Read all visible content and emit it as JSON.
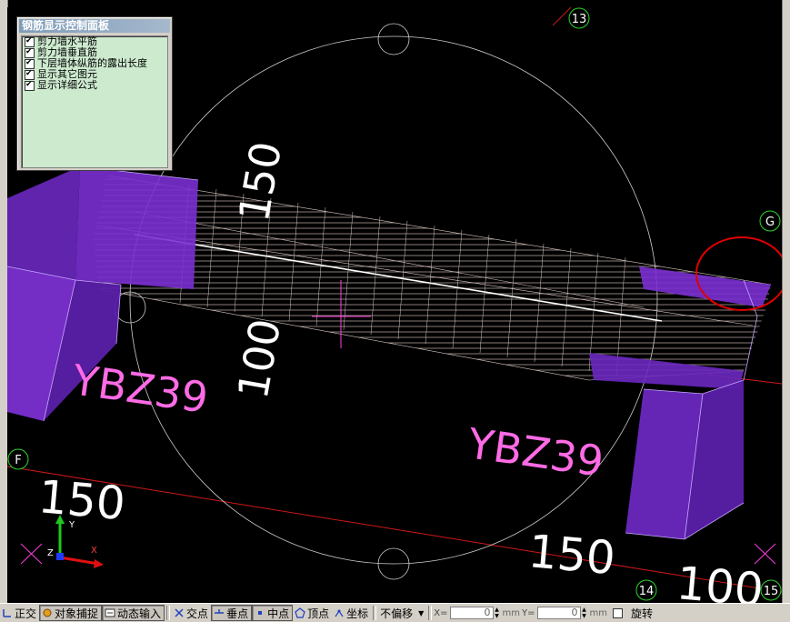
{
  "panel": {
    "title": "钢筋显示控制面板",
    "options": [
      {
        "label": "剪力墙水平筋",
        "checked": true
      },
      {
        "label": "剪力墙垂直筋",
        "checked": true
      },
      {
        "label": "下层墙体纵筋的露出长度",
        "checked": true
      },
      {
        "label": "显示其它图元",
        "checked": true
      },
      {
        "label": "显示详细公式",
        "checked": true
      }
    ]
  },
  "canvas": {
    "grid_labels": {
      "top": "13",
      "right": "G",
      "left": "F",
      "bottom_left": "14",
      "bottom_right": "15"
    },
    "component_labels": {
      "left_column": "YBZ39",
      "right_column": "YBZ39"
    },
    "dimensions": {
      "top_mid": "150",
      "mid": "100",
      "bottom_left": "150",
      "bottom_mid": "150",
      "bottom_right": "100"
    },
    "ucs": {
      "x": "X",
      "y": "Y",
      "z": "Z"
    },
    "colors": {
      "background": "#000000",
      "column": "#7a2fd0",
      "wall_rebar": "#d9c6c0",
      "dimension_text": "#ffffff",
      "label_text": "#ff6be6",
      "grid_line": "#ff2020",
      "highlight_circle": "#e00000",
      "grid_bubble": "#2bd62b"
    }
  },
  "statusbar": {
    "ortho": "正交",
    "osnap": "对象捕捉",
    "dyn_input": "动态输入",
    "intersection": "交点",
    "perpendicular": "垂点",
    "midpoint": "中点",
    "vertex": "顶点",
    "coordinate": "坐标",
    "offset_mode": "不偏移",
    "x_label": "X=",
    "x_value": "0",
    "y_label": "Y=",
    "y_value": "0",
    "unit": "mm",
    "rotate": "旋转",
    "rotate_checked": false
  }
}
